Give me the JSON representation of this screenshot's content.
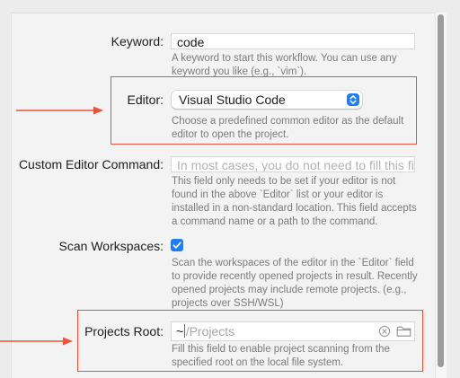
{
  "form": {
    "keyword": {
      "label": "Keyword:",
      "value": "code",
      "help_lines": [
        "A keyword to start this workflow. You can use any",
        "keyword you like (e.g., `vim`)."
      ]
    },
    "editor": {
      "label": "Editor:",
      "selected": "Visual Studio Code",
      "help_lines": [
        "Choose a predefined common editor as the default",
        "editor to open the project."
      ]
    },
    "custom_editor_command": {
      "label": "Custom Editor Command:",
      "placeholder": "In most cases, you do not need to fill this field.",
      "help_lines": [
        "This field only needs to be set if your editor is not",
        "found in the above `Editor` list or your editor is",
        "installed in a non-standard location. This field accepts",
        "a command name or a path to the command."
      ]
    },
    "scan_workspaces": {
      "label": "Scan Workspaces:",
      "checked": true,
      "help_lines": [
        "Scan the workspaces of the editor in the `Editor` field",
        "to provide recently opened projects in result. Recently",
        "opened projects may include remote projects. (e.g.,",
        "projects over SSH/WSL)"
      ]
    },
    "projects_root": {
      "label": "Projects Root:",
      "value_typed": "~",
      "value_suggestion": "/Projects",
      "help_lines": [
        "Fill this field to enable project scanning from the",
        "specified root on the local file system."
      ]
    }
  },
  "annotations": {
    "highlight_color": "#e8543c"
  },
  "colors": {
    "accent": "#1f7df5",
    "help_text": "#7b7b7b",
    "placeholder_text": "#b3b3b3"
  },
  "icons": {
    "popup": "chevron-up-down-icon",
    "checkbox": "checkmark-icon",
    "clear": "clear-x-circle-icon",
    "folder": "folder-icon"
  }
}
